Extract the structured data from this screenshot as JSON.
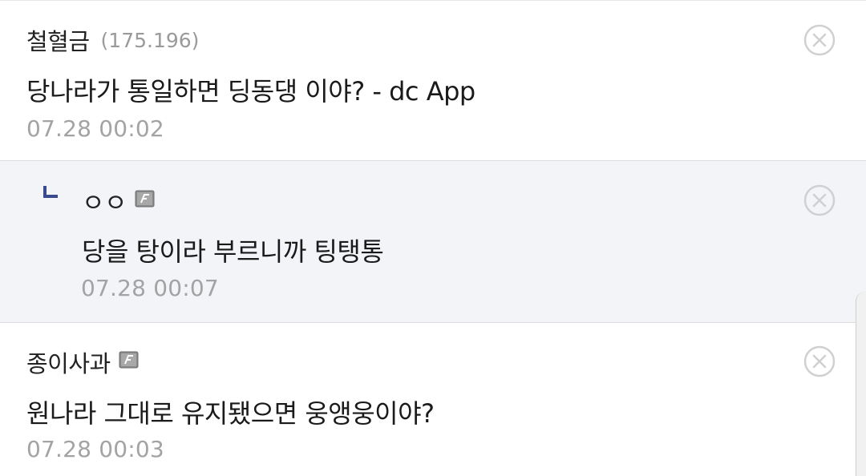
{
  "comments": [
    {
      "nickname": "철혈금",
      "ip": "(175.196)",
      "text": "당나라가 통일하면 딩동댕 이야? - dc App",
      "date": "07.28 00:02"
    },
    {
      "nickname": "ㅇㅇ",
      "text": "당을 탕이라 부르니까 팅탱통",
      "date": "07.28 00:07",
      "is_reply": true
    },
    {
      "nickname": "종이사과",
      "text": "원나라 그대로 유지됐으면 웅앵웅이야?",
      "date": "07.28 00:03"
    }
  ],
  "icons": {
    "delete": "close-circle-icon",
    "fixed_nick": "fixed-nickname-icon",
    "reply": "reply-arrow-icon"
  },
  "colors": {
    "reply_bg": "#f3f4f8",
    "reply_arrow": "#3b4a8f",
    "date": "#a3a3a3"
  }
}
